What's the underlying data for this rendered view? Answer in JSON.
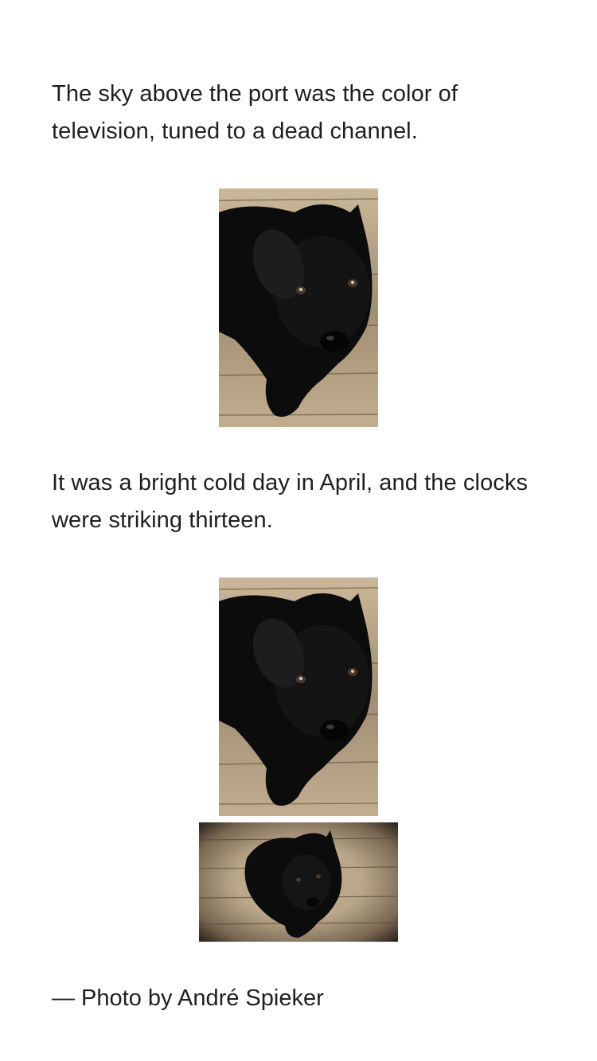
{
  "article": {
    "paragraph_1": "The sky above the port was the color of television, tuned to a dead channel.",
    "paragraph_2": "It was a bright cold day in April, and the clocks were striking thirteen.",
    "caption": "— Photo by André Spieker"
  },
  "photos": [
    {
      "name": "dog-photo-portrait"
    },
    {
      "name": "dog-photo-portrait"
    },
    {
      "name": "dog-photo-landscape"
    }
  ]
}
